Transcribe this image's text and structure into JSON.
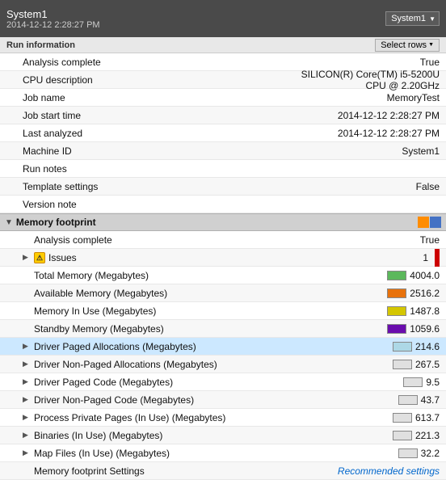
{
  "header": {
    "system": "System1",
    "date": "2014-12-12 2:28:27 PM",
    "dropdown_label": "System1"
  },
  "run_info": {
    "section_title": "Run information",
    "select_rows_label": "Select rows",
    "rows": [
      {
        "label": "Analysis complete",
        "value": "True"
      },
      {
        "label": "CPU description",
        "value": "SILICON(R) Core(TM) i5-5200U CPU @ 2.20GHz"
      },
      {
        "label": "Job name",
        "value": "MemoryTest"
      },
      {
        "label": "Job start time",
        "value": "2014-12-12 2:28:27 PM"
      },
      {
        "label": "Last analyzed",
        "value": "2014-12-12 2:28:27 PM"
      },
      {
        "label": "Machine ID",
        "value": "System1"
      },
      {
        "label": "Run notes",
        "value": ""
      },
      {
        "label": "Template settings",
        "value": "False"
      },
      {
        "label": "Version note",
        "value": ""
      }
    ]
  },
  "memory_footprint": {
    "section_title": "Memory footprint",
    "rows": [
      {
        "label": "Analysis complete",
        "value": "True",
        "type": "text",
        "indent": 1,
        "expandable": false
      },
      {
        "label": "Issues",
        "value": "1",
        "type": "issues",
        "indent": 1,
        "expandable": true
      },
      {
        "label": "Total Memory (Megabytes)",
        "value": "4004.0",
        "type": "swatch_green",
        "indent": 1,
        "expandable": false
      },
      {
        "label": "Available Memory (Megabytes)",
        "value": "2516.2",
        "type": "swatch_orange",
        "indent": 1,
        "expandable": false
      },
      {
        "label": "Memory In Use (Megabytes)",
        "value": "1487.8",
        "type": "swatch_yellow",
        "indent": 1,
        "expandable": false
      },
      {
        "label": "Standby Memory (Megabytes)",
        "value": "1059.6",
        "type": "swatch_purple",
        "indent": 1,
        "expandable": false
      },
      {
        "label": "Driver Paged Allocations (Megabytes)",
        "value": "214.6",
        "type": "swatch_lightblue",
        "indent": 1,
        "expandable": true,
        "selected": true
      },
      {
        "label": "Driver Non-Paged Allocations (Megabytes)",
        "value": "267.5",
        "type": "swatch_empty",
        "indent": 1,
        "expandable": true
      },
      {
        "label": "Driver Paged Code (Megabytes)",
        "value": "9.5",
        "type": "swatch_empty",
        "indent": 1,
        "expandable": true
      },
      {
        "label": "Driver Non-Paged Code (Megabytes)",
        "value": "43.7",
        "type": "swatch_empty",
        "indent": 1,
        "expandable": true
      },
      {
        "label": "Process Private Pages (In Use) (Megabytes)",
        "value": "613.7",
        "type": "swatch_empty",
        "indent": 1,
        "expandable": true
      },
      {
        "label": "Binaries (In Use) (Megabytes)",
        "value": "221.3",
        "type": "swatch_empty",
        "indent": 1,
        "expandable": true
      },
      {
        "label": "Map Files (In Use) (Megabytes)",
        "value": "32.2",
        "type": "swatch_empty",
        "indent": 1,
        "expandable": true
      },
      {
        "label": "Memory footprint Settings",
        "value": "Recommended settings",
        "type": "recommended",
        "indent": 1,
        "expandable": false
      }
    ]
  },
  "swatches": {
    "green": "#5cb85c",
    "orange": "#e8720c",
    "yellow": "#d4c600",
    "purple": "#6a0dad",
    "lightblue": "#add8e6",
    "empty": "#e0e0e0"
  }
}
